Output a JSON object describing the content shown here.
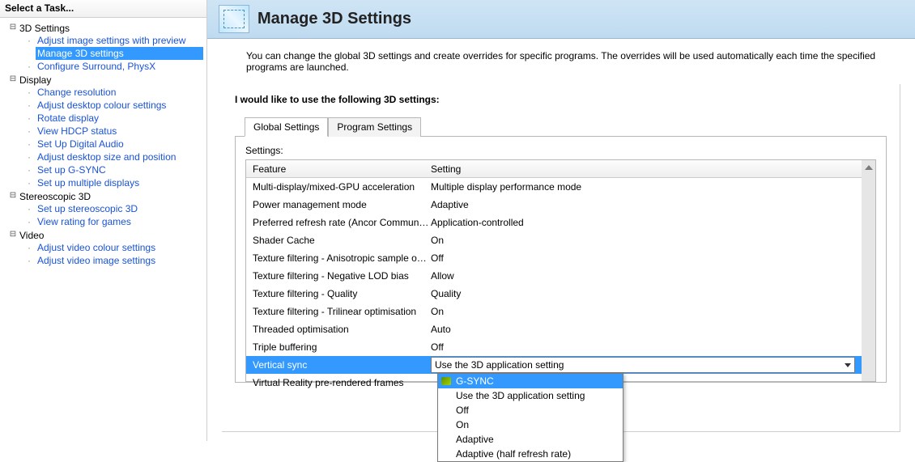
{
  "sidebar": {
    "title": "Select a Task...",
    "groups": [
      {
        "label": "3D Settings",
        "items": [
          "Adjust image settings with preview",
          "Manage 3D settings",
          "Configure Surround, PhysX"
        ],
        "selected": 1
      },
      {
        "label": "Display",
        "items": [
          "Change resolution",
          "Adjust desktop colour settings",
          "Rotate display",
          "View HDCP status",
          "Set Up Digital Audio",
          "Adjust desktop size and position",
          "Set up G-SYNC",
          "Set up multiple displays"
        ]
      },
      {
        "label": "Stereoscopic 3D",
        "items": [
          "Set up stereoscopic 3D",
          "View rating for games"
        ]
      },
      {
        "label": "Video",
        "items": [
          "Adjust video colour settings",
          "Adjust video image settings"
        ]
      }
    ]
  },
  "header": {
    "title": "Manage 3D Settings",
    "intro": "You can change the global 3D settings and create overrides for specific programs. The overrides will be used automatically each time the specified programs are launched."
  },
  "main": {
    "heading": "I would like to use the following 3D settings:",
    "tabs": [
      "Global Settings",
      "Program Settings"
    ],
    "active_tab": 0,
    "settings_label": "Settings:",
    "grid": {
      "col_feature": "Feature",
      "col_value": "Setting",
      "rows": [
        {
          "feature": "Multi-display/mixed-GPU acceleration",
          "value": "Multiple display performance mode"
        },
        {
          "feature": "Power management mode",
          "value": "Adaptive"
        },
        {
          "feature": "Preferred refresh rate (Ancor Communicat...",
          "value": "Application-controlled"
        },
        {
          "feature": "Shader Cache",
          "value": "On"
        },
        {
          "feature": "Texture filtering - Anisotropic sample opti...",
          "value": "Off"
        },
        {
          "feature": "Texture filtering - Negative LOD bias",
          "value": "Allow"
        },
        {
          "feature": "Texture filtering - Quality",
          "value": "Quality"
        },
        {
          "feature": "Texture filtering - Trilinear optimisation",
          "value": "On"
        },
        {
          "feature": "Threaded optimisation",
          "value": "Auto"
        },
        {
          "feature": "Triple buffering",
          "value": "Off"
        },
        {
          "feature": "Vertical sync",
          "value": "Use the 3D application setting",
          "selected": true
        },
        {
          "feature": "Virtual Reality pre-rendered frames",
          "value": ""
        }
      ]
    },
    "dropdown": {
      "selected": 0,
      "options": [
        "G-SYNC",
        "Use the 3D application setting",
        "Off",
        "On",
        "Adaptive",
        "Adaptive (half refresh rate)"
      ]
    }
  }
}
